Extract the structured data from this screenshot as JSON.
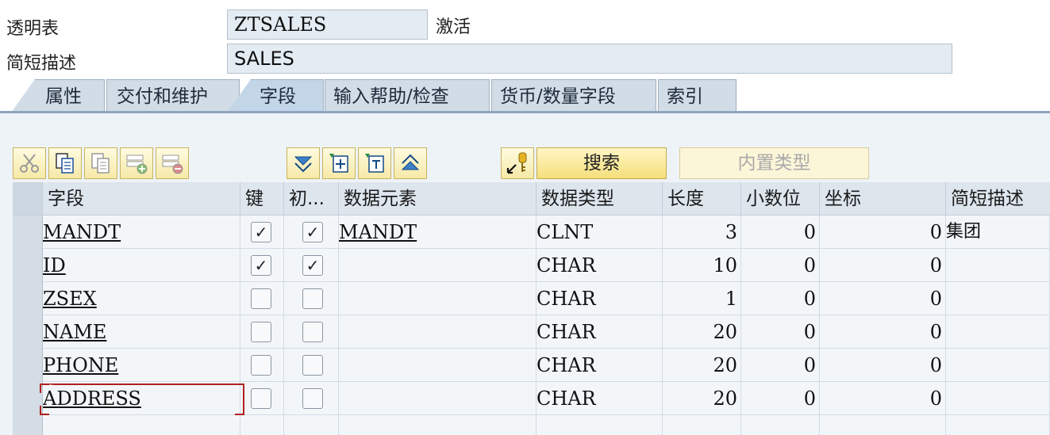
{
  "header": {
    "table_label": "透明表",
    "table_name": "ZTSALES",
    "status": "激活",
    "desc_label": "简短描述",
    "desc_value": "SALES"
  },
  "tabs": [
    {
      "label": "属性",
      "active": false
    },
    {
      "label": "交付和维护",
      "active": false
    },
    {
      "label": "字段",
      "active": true
    },
    {
      "label": "输入帮助/检查",
      "active": false
    },
    {
      "label": "货币/数量字段",
      "active": false
    },
    {
      "label": "索引",
      "active": false
    }
  ],
  "toolbar": {
    "icons": [
      "cut-icon",
      "copy-icon",
      "paste-icon",
      "insert-row-icon",
      "delete-row-icon",
      "sort-down-icon",
      "insert-include-icon",
      "expand-include-icon",
      "sort-up-icon",
      "key-search-icon"
    ],
    "search_label": "搜索",
    "builtin_type_label": "内置类型"
  },
  "columns": {
    "field": "字段",
    "key": "键",
    "initial": "初...",
    "data_element": "数据元素",
    "data_type": "数据类型",
    "length": "长度",
    "decimals": "小数位",
    "coordinate": "坐标",
    "short_desc": "简短描述"
  },
  "rows": [
    {
      "field": "MANDT",
      "key": true,
      "initial": true,
      "data_element": "MANDT",
      "data_type": "CLNT",
      "length": "3",
      "decimals": "0",
      "coordinate": "0",
      "short_desc": "集团"
    },
    {
      "field": "ID",
      "key": true,
      "initial": true,
      "data_element": "",
      "data_type": "CHAR",
      "length": "10",
      "decimals": "0",
      "coordinate": "0",
      "short_desc": ""
    },
    {
      "field": "ZSEX",
      "key": false,
      "initial": false,
      "data_element": "",
      "data_type": "CHAR",
      "length": "1",
      "decimals": "0",
      "coordinate": "0",
      "short_desc": ""
    },
    {
      "field": "NAME",
      "key": false,
      "initial": false,
      "data_element": "",
      "data_type": "CHAR",
      "length": "20",
      "decimals": "0",
      "coordinate": "0",
      "short_desc": ""
    },
    {
      "field": "PHONE",
      "key": false,
      "initial": false,
      "data_element": "",
      "data_type": "CHAR",
      "length": "20",
      "decimals": "0",
      "coordinate": "0",
      "short_desc": ""
    },
    {
      "field": "ADDRESS",
      "key": false,
      "initial": false,
      "data_element": "",
      "data_type": "CHAR",
      "length": "20",
      "decimals": "0",
      "coordinate": "0",
      "short_desc": ""
    }
  ],
  "colors": {
    "accent": "#c3d6e8",
    "toolbar_button": "#f6e9a8",
    "focus_marker": "#b01e1e"
  }
}
